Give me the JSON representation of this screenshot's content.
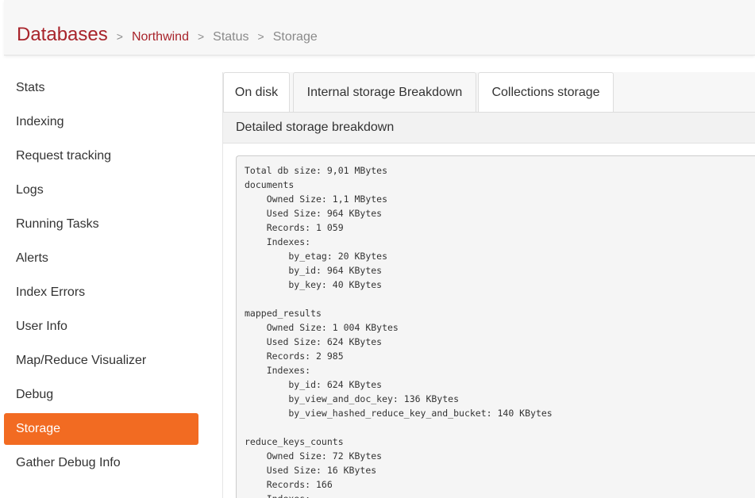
{
  "breadcrumb": {
    "root": "Databases",
    "separator": ">",
    "database": "Northwind",
    "section": "Status",
    "current": "Storage"
  },
  "sidebar": {
    "items": [
      {
        "label": "Stats"
      },
      {
        "label": "Indexing"
      },
      {
        "label": "Request tracking"
      },
      {
        "label": "Logs"
      },
      {
        "label": "Running Tasks"
      },
      {
        "label": "Alerts"
      },
      {
        "label": "Index Errors"
      },
      {
        "label": "User Info"
      },
      {
        "label": "Map/Reduce Visualizer"
      },
      {
        "label": "Debug"
      },
      {
        "label": "Storage",
        "active": true
      },
      {
        "label": "Gather Debug Info"
      }
    ]
  },
  "tabs": [
    {
      "label": "On disk"
    },
    {
      "label": "Internal storage Breakdown"
    },
    {
      "label": "Collections storage"
    }
  ],
  "panel": {
    "title": "Detailed storage breakdown",
    "report": "Total db size: 9,01 MBytes\ndocuments\n    Owned Size: 1,1 MBytes\n    Used Size: 964 KBytes\n    Records: 1 059\n    Indexes:\n        by_etag: 20 KBytes\n        by_id: 964 KBytes\n        by_key: 40 KBytes\n\nmapped_results\n    Owned Size: 1 004 KBytes\n    Used Size: 624 KBytes\n    Records: 2 985\n    Indexes:\n        by_id: 624 KBytes\n        by_view_and_doc_key: 136 KBytes\n        by_view_hashed_reduce_key_and_bucket: 140 KBytes\n\nreduce_keys_counts\n    Owned Size: 72 KBytes\n    Used Size: 16 KBytes\n    Records: 166\n    Indexes:"
  },
  "colors": {
    "accent": "#f26b22",
    "brand": "#a8242b",
    "muted": "#8a8a8a"
  }
}
